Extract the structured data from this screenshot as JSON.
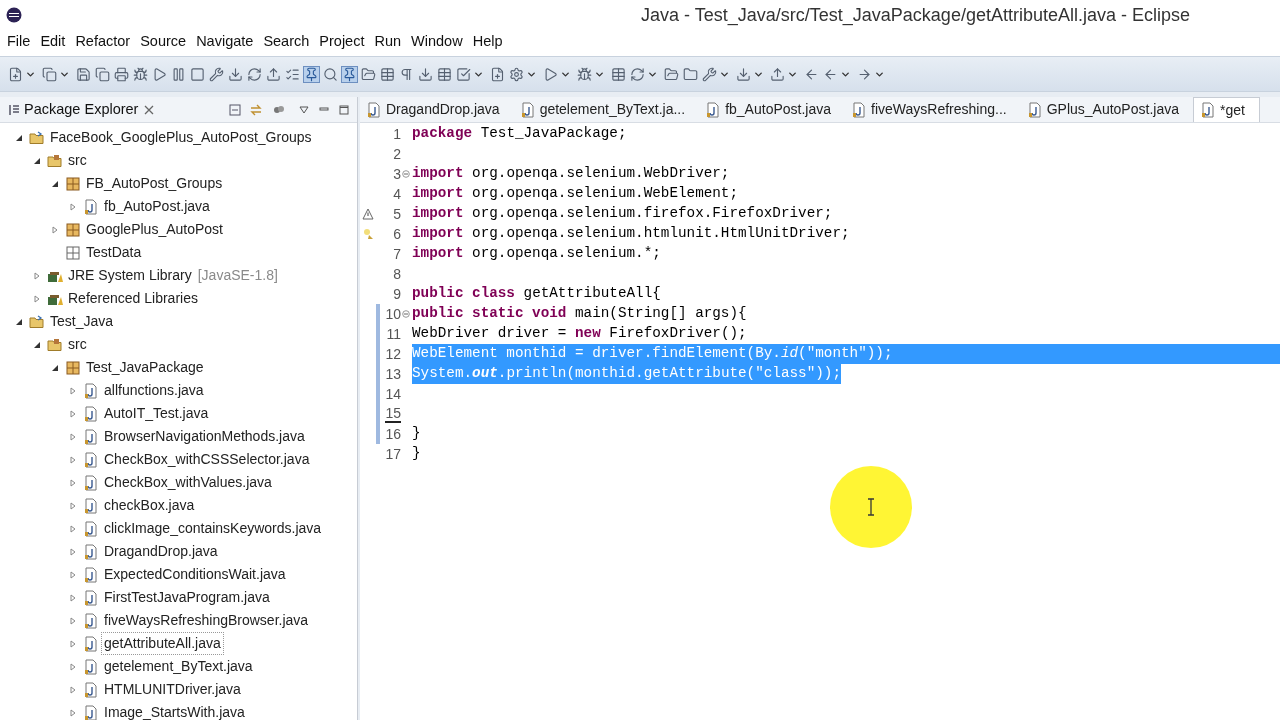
{
  "window": {
    "title": "Java - Test_Java/src/Test_JavaPackage/getAttributeAll.java - Eclipse"
  },
  "menu": [
    "File",
    "Edit",
    "Refactor",
    "Source",
    "Navigate",
    "Search",
    "Project",
    "Run",
    "Window",
    "Help"
  ],
  "explorer": {
    "title": "Package Explorer",
    "tree": [
      {
        "label": "FaceBook_GooglePlus_AutoPost_Groups",
        "kind": "project",
        "expanded": true,
        "selected": false,
        "children": [
          {
            "label": "src",
            "kind": "folder",
            "expanded": true,
            "selected": false,
            "children": [
              {
                "label": "FB_AutoPost_Groups",
                "kind": "package",
                "expanded": true,
                "selected": false,
                "children": [
                  {
                    "label": "fb_AutoPost.java",
                    "kind": "file",
                    "expanded": false,
                    "selected": false
                  }
                ]
              },
              {
                "label": "GooglePlus_AutoPost",
                "kind": "package",
                "expanded": false,
                "selected": false
              },
              {
                "label": "TestData",
                "kind": "empty-package",
                "selected": false
              }
            ]
          },
          {
            "label": "JRE System Library",
            "suffix": "[JavaSE-1.8]",
            "kind": "library",
            "expanded": false,
            "selected": false
          },
          {
            "label": "Referenced Libraries",
            "kind": "library",
            "expanded": false,
            "selected": false
          }
        ]
      },
      {
        "label": "Test_Java",
        "kind": "project",
        "expanded": true,
        "selected": false,
        "children": [
          {
            "label": "src",
            "kind": "folder",
            "expanded": true,
            "selected": false,
            "children": [
              {
                "label": "Test_JavaPackage",
                "kind": "package",
                "expanded": true,
                "selected": false,
                "children": [
                  {
                    "label": "allfunctions.java",
                    "kind": "file",
                    "expanded": false,
                    "selected": false
                  },
                  {
                    "label": "AutoIT_Test.java",
                    "kind": "file",
                    "expanded": false,
                    "selected": false
                  },
                  {
                    "label": "BrowserNavigationMethods.java",
                    "kind": "file",
                    "expanded": false,
                    "selected": false
                  },
                  {
                    "label": "CheckBox_withCSSSelector.java",
                    "kind": "file",
                    "expanded": false,
                    "selected": false
                  },
                  {
                    "label": "CheckBox_withValues.java",
                    "kind": "file",
                    "expanded": false,
                    "selected": false
                  },
                  {
                    "label": "checkBox.java",
                    "kind": "file",
                    "expanded": false,
                    "selected": false
                  },
                  {
                    "label": "clickImage_containsKeywords.java",
                    "kind": "file",
                    "expanded": false,
                    "selected": false
                  },
                  {
                    "label": "DragandDrop.java",
                    "kind": "file",
                    "expanded": false,
                    "selected": false
                  },
                  {
                    "label": "ExpectedConditionsWait.java",
                    "kind": "file",
                    "expanded": false,
                    "selected": false
                  },
                  {
                    "label": "FirstTestJavaProgram.java",
                    "kind": "file",
                    "expanded": false,
                    "selected": false
                  },
                  {
                    "label": "fiveWaysRefreshingBrowser.java",
                    "kind": "file",
                    "expanded": false,
                    "selected": false
                  },
                  {
                    "label": "getAttributeAll.java",
                    "kind": "file",
                    "expanded": false,
                    "selected": true
                  },
                  {
                    "label": "getelement_ByText.java",
                    "kind": "file",
                    "expanded": false,
                    "selected": false
                  },
                  {
                    "label": "HTMLUNITDriver.java",
                    "kind": "file",
                    "expanded": false,
                    "selected": false
                  },
                  {
                    "label": "Image_StartsWith.java",
                    "kind": "file",
                    "expanded": false,
                    "selected": false
                  }
                ]
              }
            ]
          }
        ]
      }
    ]
  },
  "editor": {
    "tabs": [
      {
        "label": "DragandDrop.java",
        "selected": false
      },
      {
        "label": "getelement_ByText.ja...",
        "selected": false
      },
      {
        "label": "fb_AutoPost.java",
        "selected": false
      },
      {
        "label": "fiveWaysRefreshing...",
        "selected": false
      },
      {
        "label": "GPlus_AutoPost.java",
        "selected": false
      },
      {
        "label": "*get",
        "selected": true
      }
    ],
    "lines": [
      {
        "number": "1",
        "kind": "plain",
        "fold": false,
        "in_range": false,
        "current": false,
        "selected": false,
        "eol_selected": false,
        "segments": [
          {
            "text": "package",
            "kind": "keyword"
          },
          {
            "text": " Test_JavaPackage;",
            "kind": "plain"
          }
        ]
      },
      {
        "number": "2",
        "kind": "plain",
        "fold": false,
        "in_range": false,
        "current": false,
        "selected": false,
        "eol_selected": false
      },
      {
        "number": "3",
        "kind": "plain",
        "fold": true,
        "in_range": false,
        "current": false,
        "selected": false,
        "eol_selected": false,
        "segments": [
          {
            "text": "import",
            "kind": "keyword"
          },
          {
            "text": " org.openqa.selenium.WebDriver;",
            "kind": "plain"
          }
        ]
      },
      {
        "number": "4",
        "kind": "plain",
        "fold": false,
        "in_range": false,
        "current": false,
        "selected": false,
        "eol_selected": false,
        "segments": [
          {
            "text": "import",
            "kind": "keyword"
          },
          {
            "text": " org.openqa.selenium.WebElement;",
            "kind": "plain"
          }
        ]
      },
      {
        "number": "5",
        "kind": "warning",
        "fold": false,
        "in_range": false,
        "current": false,
        "selected": false,
        "eol_selected": false,
        "segments": [
          {
            "text": "import",
            "kind": "keyword"
          },
          {
            "text": " org.openqa.selenium.firefox.FirefoxDriver;",
            "kind": "plain"
          }
        ]
      },
      {
        "number": "6",
        "kind": "quickfix",
        "fold": false,
        "in_range": false,
        "current": false,
        "selected": false,
        "eol_selected": false,
        "segments": [
          {
            "text": "import",
            "kind": "keyword"
          },
          {
            "text": " org.openqa.selenium.htmlunit.HtmlUnitDriver;",
            "kind": "plain"
          }
        ]
      },
      {
        "number": "7",
        "kind": "plain",
        "fold": false,
        "in_range": false,
        "current": false,
        "selected": false,
        "eol_selected": false,
        "segments": [
          {
            "text": "import",
            "kind": "keyword"
          },
          {
            "text": " org.openqa.selenium.*;",
            "kind": "plain"
          }
        ]
      },
      {
        "number": "8",
        "kind": "plain",
        "fold": false,
        "in_range": false,
        "current": false,
        "selected": false,
        "eol_selected": false
      },
      {
        "number": "9",
        "kind": "plain",
        "fold": false,
        "in_range": false,
        "current": false,
        "selected": false,
        "eol_selected": false,
        "segments": [
          {
            "text": "public class",
            "kind": "keyword"
          },
          {
            "text": " getAttributeAll{",
            "kind": "plain"
          }
        ]
      },
      {
        "number": "10",
        "kind": "plain",
        "fold": true,
        "in_range": true,
        "current": false,
        "selected": false,
        "eol_selected": false,
        "segments": [
          {
            "text": "public static void",
            "kind": "keyword"
          },
          {
            "text": " main(String[] args){",
            "kind": "plain"
          }
        ]
      },
      {
        "number": "11",
        "kind": "plain",
        "fold": false,
        "in_range": true,
        "current": false,
        "selected": false,
        "eol_selected": false,
        "segments": [
          {
            "text": "WebDriver driver = ",
            "kind": "plain"
          },
          {
            "text": "new",
            "kind": "keyword"
          },
          {
            "text": " FirefoxDriver();",
            "kind": "plain"
          }
        ]
      },
      {
        "number": "12",
        "kind": "plain",
        "fold": false,
        "in_range": true,
        "current": false,
        "selected": true,
        "eol_selected": true,
        "segments": [
          {
            "text": "WebElement monthid = driver.findElement(By.",
            "kind": "plain"
          },
          {
            "text": "id",
            "kind": "italic"
          },
          {
            "text": "(\"month\"));",
            "kind": "plain"
          }
        ]
      },
      {
        "number": "13",
        "kind": "plain",
        "fold": false,
        "in_range": true,
        "current": false,
        "selected": true,
        "eol_selected": false,
        "segments": [
          {
            "text": "System.",
            "kind": "plain"
          },
          {
            "text": "out",
            "kind": "static"
          },
          {
            "text": ".println(monthid.getAttribute(\"class\"));",
            "kind": "plain"
          }
        ]
      },
      {
        "number": "14",
        "kind": "plain",
        "fold": false,
        "in_range": true,
        "current": false,
        "selected": false,
        "eol_selected": false
      },
      {
        "number": "15",
        "kind": "plain",
        "fold": false,
        "in_range": true,
        "current": true,
        "selected": false,
        "eol_selected": false
      },
      {
        "number": "16",
        "kind": "plain",
        "fold": false,
        "in_range": true,
        "current": false,
        "selected": false,
        "eol_selected": false,
        "segments": [
          {
            "text": "}",
            "kind": "plain"
          }
        ]
      },
      {
        "number": "17",
        "kind": "plain",
        "fold": false,
        "in_range": false,
        "current": false,
        "selected": false,
        "eol_selected": false,
        "segments": [
          {
            "text": "}",
            "kind": "plain"
          }
        ]
      }
    ]
  }
}
